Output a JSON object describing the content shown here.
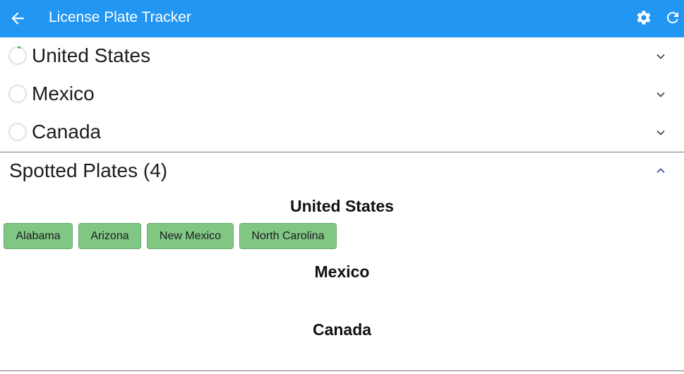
{
  "app": {
    "title": "License Plate Tracker"
  },
  "countries": [
    {
      "name": "United States"
    },
    {
      "name": "Mexico"
    },
    {
      "name": "Canada"
    }
  ],
  "spotted": {
    "label": "Spotted Plates (4)",
    "groups": [
      {
        "country": "United States",
        "plates": [
          "Alabama",
          "Arizona",
          "New Mexico",
          "North Carolina"
        ]
      },
      {
        "country": "Mexico",
        "plates": []
      },
      {
        "country": "Canada",
        "plates": []
      }
    ]
  },
  "colors": {
    "appbar": "#2196f3",
    "chip": "#81c784",
    "progress": "#4caf50",
    "chevron": "#49454f",
    "chevron_up": "#3f51b5"
  },
  "icons": [
    "back-arrow-icon",
    "gear-icon",
    "refresh-icon",
    "chevron-down-icon",
    "chevron-up-icon",
    "progress-ring-icon"
  ]
}
